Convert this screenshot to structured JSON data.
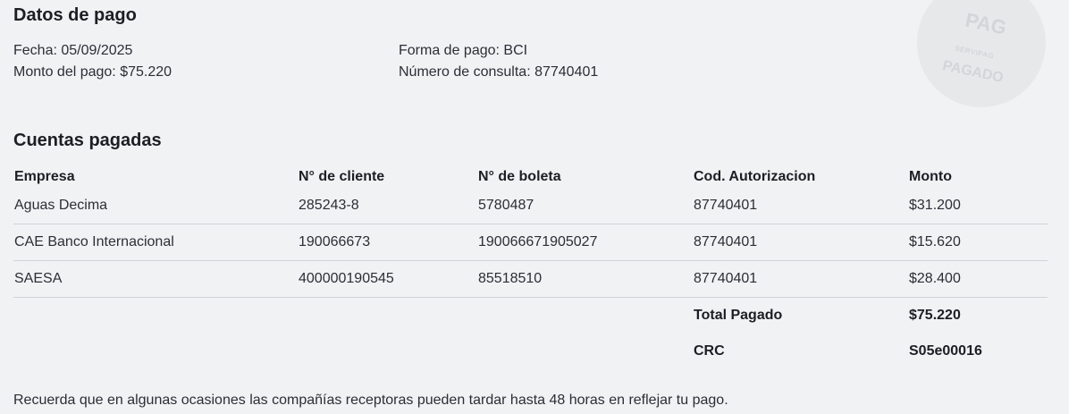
{
  "payment": {
    "title": "Datos de pago",
    "fecha": "Fecha: 05/09/2025",
    "monto": "Monto del pago: $75.220",
    "forma": "Forma de pago: BCI",
    "consulta": "Número de consulta: 87740401"
  },
  "stamp": {
    "line1": "PAG",
    "line2": "SERVIPAG",
    "line3": "PAGADO"
  },
  "accounts": {
    "title": "Cuentas pagadas",
    "headers": [
      "Empresa",
      "N° de cliente",
      "N° de boleta",
      "Cod. Autorizacion",
      "Monto"
    ],
    "rows": [
      [
        "Aguas Decima",
        "285243-8",
        "5780487",
        "87740401",
        "$31.200"
      ],
      [
        "CAE Banco Internacional",
        "190066673",
        "190066671905027",
        "87740401",
        "$15.620"
      ],
      [
        "SAESA",
        "400000190545",
        "85518510",
        "87740401",
        "$28.400"
      ]
    ],
    "total_label": "Total Pagado",
    "total_value": "$75.220",
    "crc_label": "CRC",
    "crc_value": "S05e00016"
  },
  "note": "Recuerda que en algunas ocasiones las compañías receptoras pueden tardar hasta 48 horas en reflejar tu pago."
}
